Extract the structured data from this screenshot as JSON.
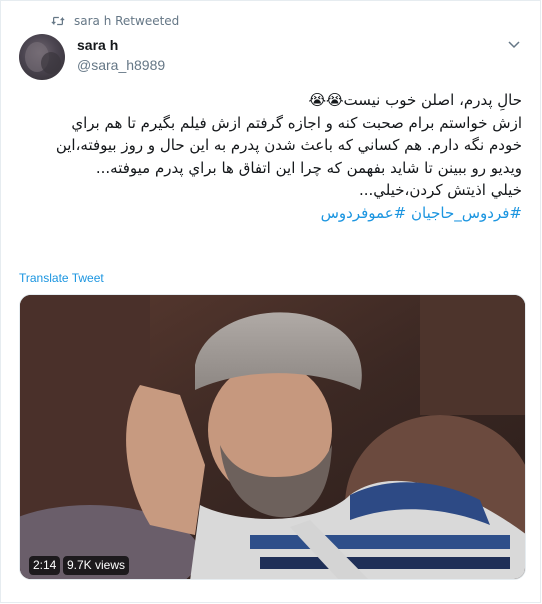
{
  "retweet": {
    "label": "sara h Retweeted"
  },
  "author": {
    "name": "sara h",
    "handle": "@sara_h8989"
  },
  "tweet": {
    "lines": [
      "حالِ پدرم، اصلن خوب نیست😭😭",
      "ازش خواستم برام صحبت کنه و اجازه گرفتم ازش فیلم بگیرم تا هم براي",
      "خودم نگه دارم. هم کساني که باعث شدن پدرم به این حال و روز بیوفته،این",
      "ویدیو رو ببینن تا شاید بفهمن که چرا این اتفاق ها براي پدرم میوفته...",
      "خیلي اذیتش کردن،خیلي..."
    ],
    "hashtags": [
      "#فردوس_حاجیان",
      "#عموفردوس"
    ]
  },
  "translate_label": "Translate Tweet",
  "media": {
    "duration": "2:14",
    "views": "9.7K views"
  },
  "icons": {
    "retweet": "retweet-icon",
    "caret": "chevron-down-icon"
  },
  "colors": {
    "link": "#1b95e0",
    "secondary": "#657786",
    "text": "#14171a"
  }
}
